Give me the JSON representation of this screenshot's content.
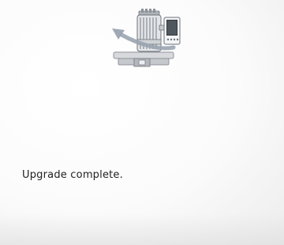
{
  "dialog": {
    "message": "Upgrade complete."
  },
  "illustration": {
    "icon": "embroidery-machine-upgrade-icon",
    "arrow_color": "#9aa4b0",
    "machine_color": "#c9ccd1",
    "panel_color": "#33373d"
  }
}
